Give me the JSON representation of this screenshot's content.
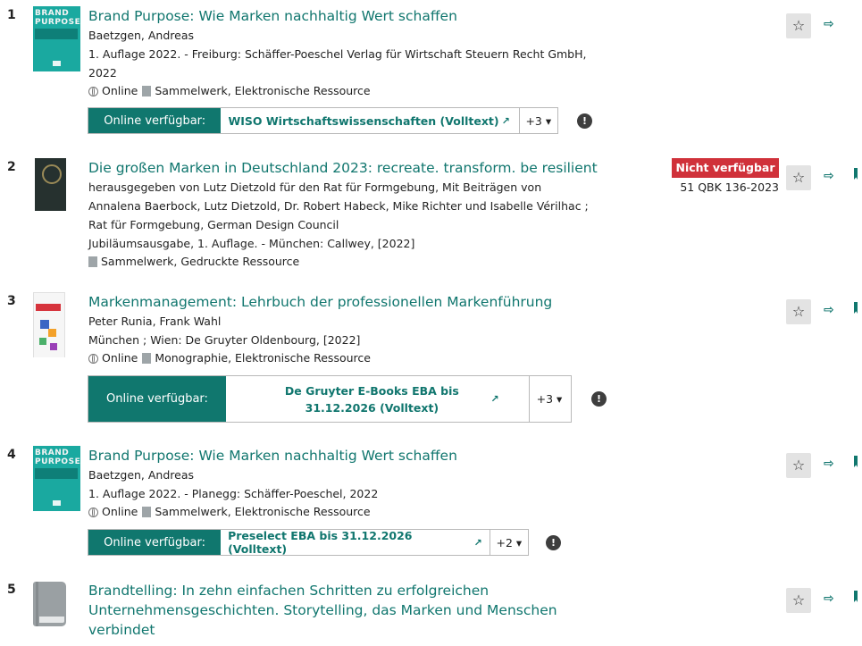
{
  "results": [
    {
      "number": "1",
      "title": "Brand Purpose: Wie Marken nachhaltig Wert schaffen",
      "author": "Baetzgen, Andreas",
      "publication": "1. Auflage 2022. - Freiburg: Schäffer-Poeschel Verlag für Wirtschaft Steuern Recht GmbH, 2022",
      "online": "Online",
      "type": "Sammelwerk, Elektronische Ressource",
      "online_label": "Online verfügbar:",
      "link": "WISO Wirtschaftswissenschaften (Volltext)",
      "more": "+3 ▾",
      "cover_text": "BRAND PURPOSE"
    },
    {
      "number": "2",
      "title": "Die großen Marken in Deutschland 2023: recreate. transform. be resilient",
      "author": "herausgegeben von Lutz Dietzold für den Rat für Formgebung, Mit Beiträgen von Annalena Baerbock, Lutz Dietzold, Dr. Robert Habeck, Mike Richter und Isabelle Vérilhac ; Rat für Formgebung, German Design Council",
      "publication": "Jubiläumsausgabe, 1. Auflage. - München: Callwey, [2022]",
      "type": "Sammelwerk, Gedruckte Ressource",
      "status": "Nicht verfügbar",
      "signature": "51 QBK 136-2023"
    },
    {
      "number": "3",
      "title": "Markenmanagement: Lehrbuch der professionellen Markenführung",
      "author": "Peter Runia, Frank Wahl",
      "publication": "München ; Wien: De Gruyter Oldenbourg, [2022]",
      "online": "Online",
      "type": "Monographie, Elektronische Ressource",
      "online_label": "Online verfügbar:",
      "link": "De Gruyter E-Books EBA bis 31.12.2026 (Volltext)",
      "more": "+3 ▾"
    },
    {
      "number": "4",
      "title": "Brand Purpose: Wie Marken nachhaltig Wert schaffen",
      "author": "Baetzgen, Andreas",
      "publication": "1. Auflage 2022. - Planegg: Schäffer-Poeschel, 2022",
      "online": "Online",
      "type": "Sammelwerk, Elektronische Ressource",
      "online_label": "Online verfügbar:",
      "link": "Preselect EBA bis 31.12.2026 (Volltext)",
      "more": "+2 ▾",
      "cover_text": "BRAND PURPOSE"
    },
    {
      "number": "5",
      "title": "Brandtelling: In zehn einfachen Schritten zu erfolgreichen Unternehmensgeschichten. Storytelling, das Marken und Menschen verbindet"
    }
  ],
  "icons": {
    "star": "☆",
    "share": "⇨",
    "external": "↗",
    "info": "!"
  },
  "colors": {
    "accent": "#10776e",
    "title": "#10766e",
    "unavailable": "#d0313a"
  }
}
